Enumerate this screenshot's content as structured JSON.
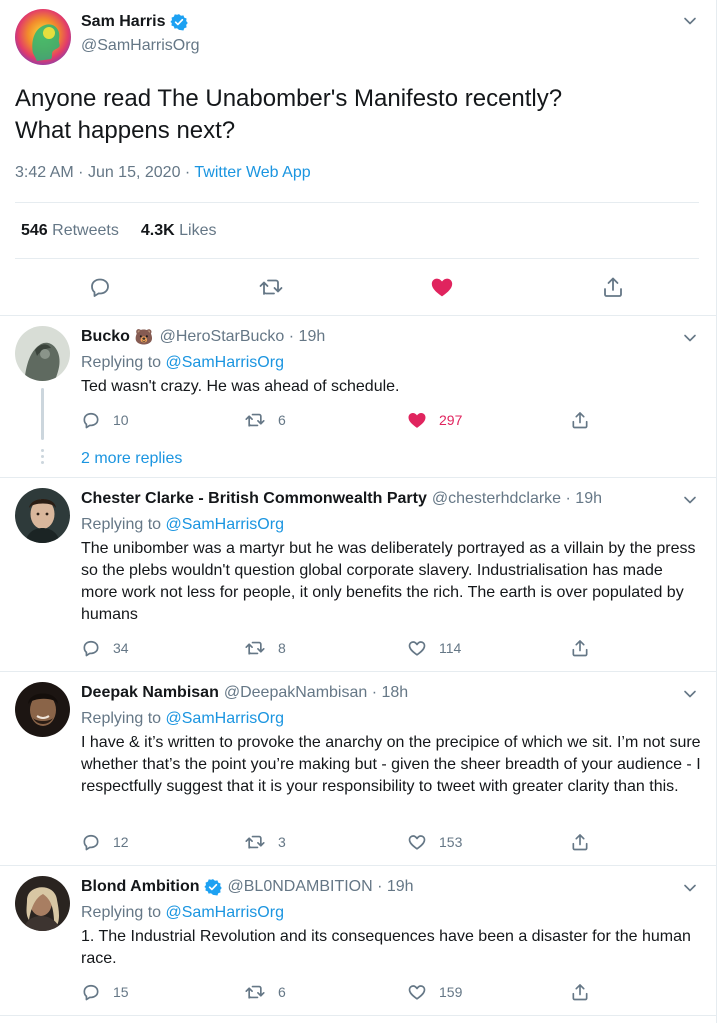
{
  "main_tweet": {
    "author_name": "Sam Harris",
    "author_handle": "@SamHarrisOrg",
    "verified": true,
    "text": "Anyone read The Unabomber's Manifesto recently?\nWhat happens next?",
    "time": "3:42 AM",
    "date": "Jun 15, 2020",
    "dot": "·",
    "source": "Twitter Web App",
    "retweets_count": "546",
    "retweets_label": "Retweets",
    "likes_count": "4.3K",
    "likes_label": "Likes"
  },
  "replies": [
    {
      "name": "Bucko",
      "emoji": "🐻",
      "handle": "@HeroStarBucko",
      "time": "· 19h",
      "replying_prefix": "Replying to",
      "replying_to": "@SamHarrisOrg",
      "text": "Ted wasn't crazy. He was ahead of schedule.",
      "replies": "10",
      "retweets": "6",
      "likes": "297",
      "liked": true,
      "more_replies": "2 more replies"
    },
    {
      "name": "Chester Clarke - British Commonwealth Party",
      "handle": "@chesterhdclarke",
      "time": "· 19h",
      "replying_prefix": "Replying to",
      "replying_to": "@SamHarrisOrg",
      "text": "The unibomber was a martyr but he was deliberately portrayed as a villain by the press so the plebs wouldn't question global corporate slavery. Industrialisation has made more work not less for people, it only benefits the rich. The earth is over populated by humans",
      "replies": "34",
      "retweets": "8",
      "likes": "114",
      "liked": false
    },
    {
      "name": "Deepak Nambisan",
      "handle": "@DeepakNambisan",
      "time": "· 18h",
      "replying_prefix": "Replying to",
      "replying_to": "@SamHarrisOrg",
      "text": "I have & it’s written to provoke the anarchy on the precipice of which we sit. I’m not sure whether that’s the point you’re making but - given the sheer breadth of your audience - I respectfully suggest that it is your responsibility to tweet with greater clarity than this.",
      "replies": "12",
      "retweets": "3",
      "likes": "153",
      "liked": false
    },
    {
      "name": "Blond Ambition",
      "verified": true,
      "handle": "@BL0NDAMBITION",
      "time": "· 19h",
      "replying_prefix": "Replying to",
      "replying_to": "@SamHarrisOrg",
      "text": "1. The Industrial Revolution and its consequences have been a disaster for the human race.",
      "replies": "15",
      "retweets": "6",
      "likes": "159",
      "liked": false
    }
  ],
  "colors": {
    "link": "#1b95e0",
    "like": "#e0245e",
    "muted": "#657786",
    "border": "#e6ecf0"
  },
  "icons": [
    "verified-badge-icon",
    "chevron-down-icon",
    "reply-icon",
    "retweet-icon",
    "like-icon",
    "share-icon"
  ]
}
